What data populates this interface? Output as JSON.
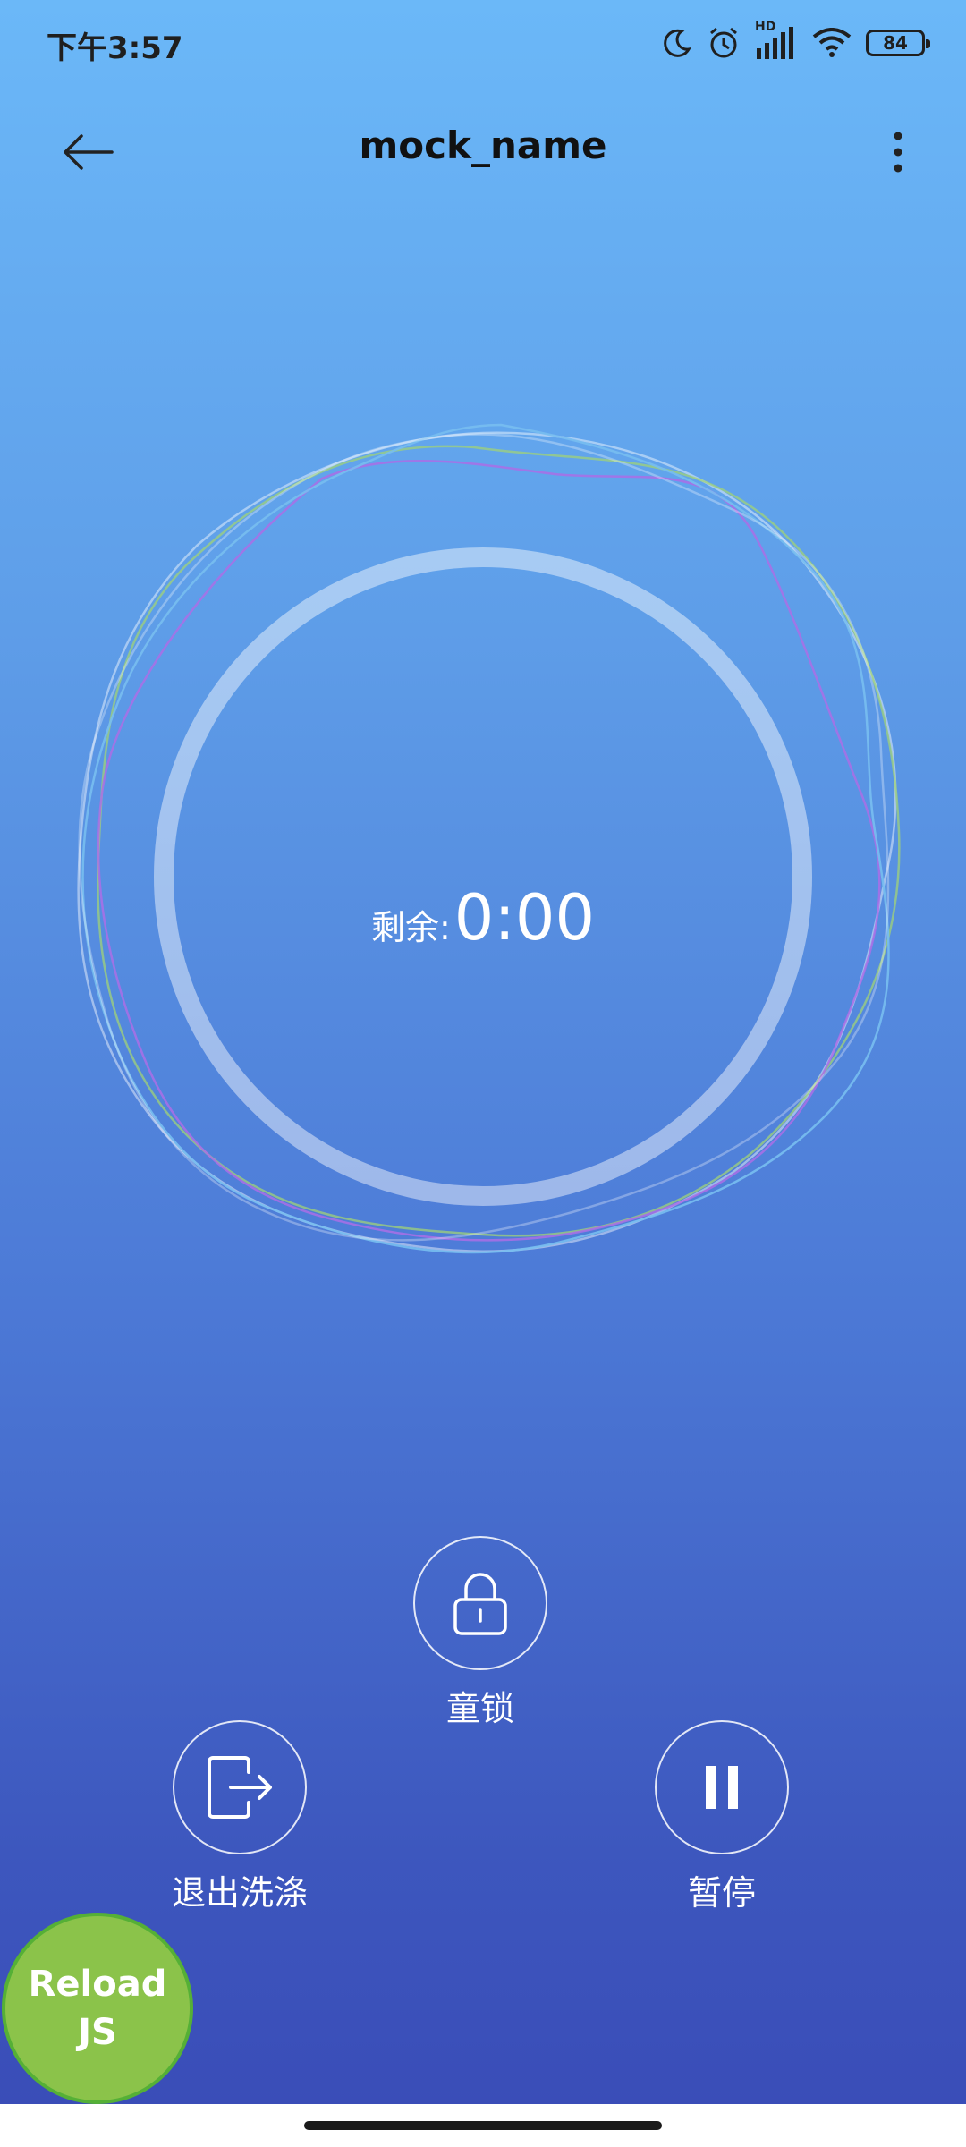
{
  "status_bar": {
    "time": "下午3:57",
    "battery": "84",
    "network_badge": "HD",
    "icons": [
      "moon-icon",
      "alarm-icon",
      "signal-icon",
      "wifi-icon",
      "battery-icon"
    ]
  },
  "header": {
    "title": "mock_name",
    "back_icon": "arrow-left-icon",
    "more_icon": "more-vertical-icon"
  },
  "timer": {
    "label": "剩余:",
    "value": "0:00"
  },
  "actions": {
    "child_lock": {
      "label": "童锁",
      "icon": "lock-icon"
    },
    "exit_wash": {
      "label": "退出洗涤",
      "icon": "exit-icon"
    },
    "pause": {
      "label": "暂停",
      "icon": "pause-icon"
    }
  },
  "dev": {
    "reload_label": "Reload JS"
  },
  "colors": {
    "background_top": "#6bb8f8",
    "background_bottom": "#3a4db8",
    "reload_button": "#8bc34a"
  }
}
